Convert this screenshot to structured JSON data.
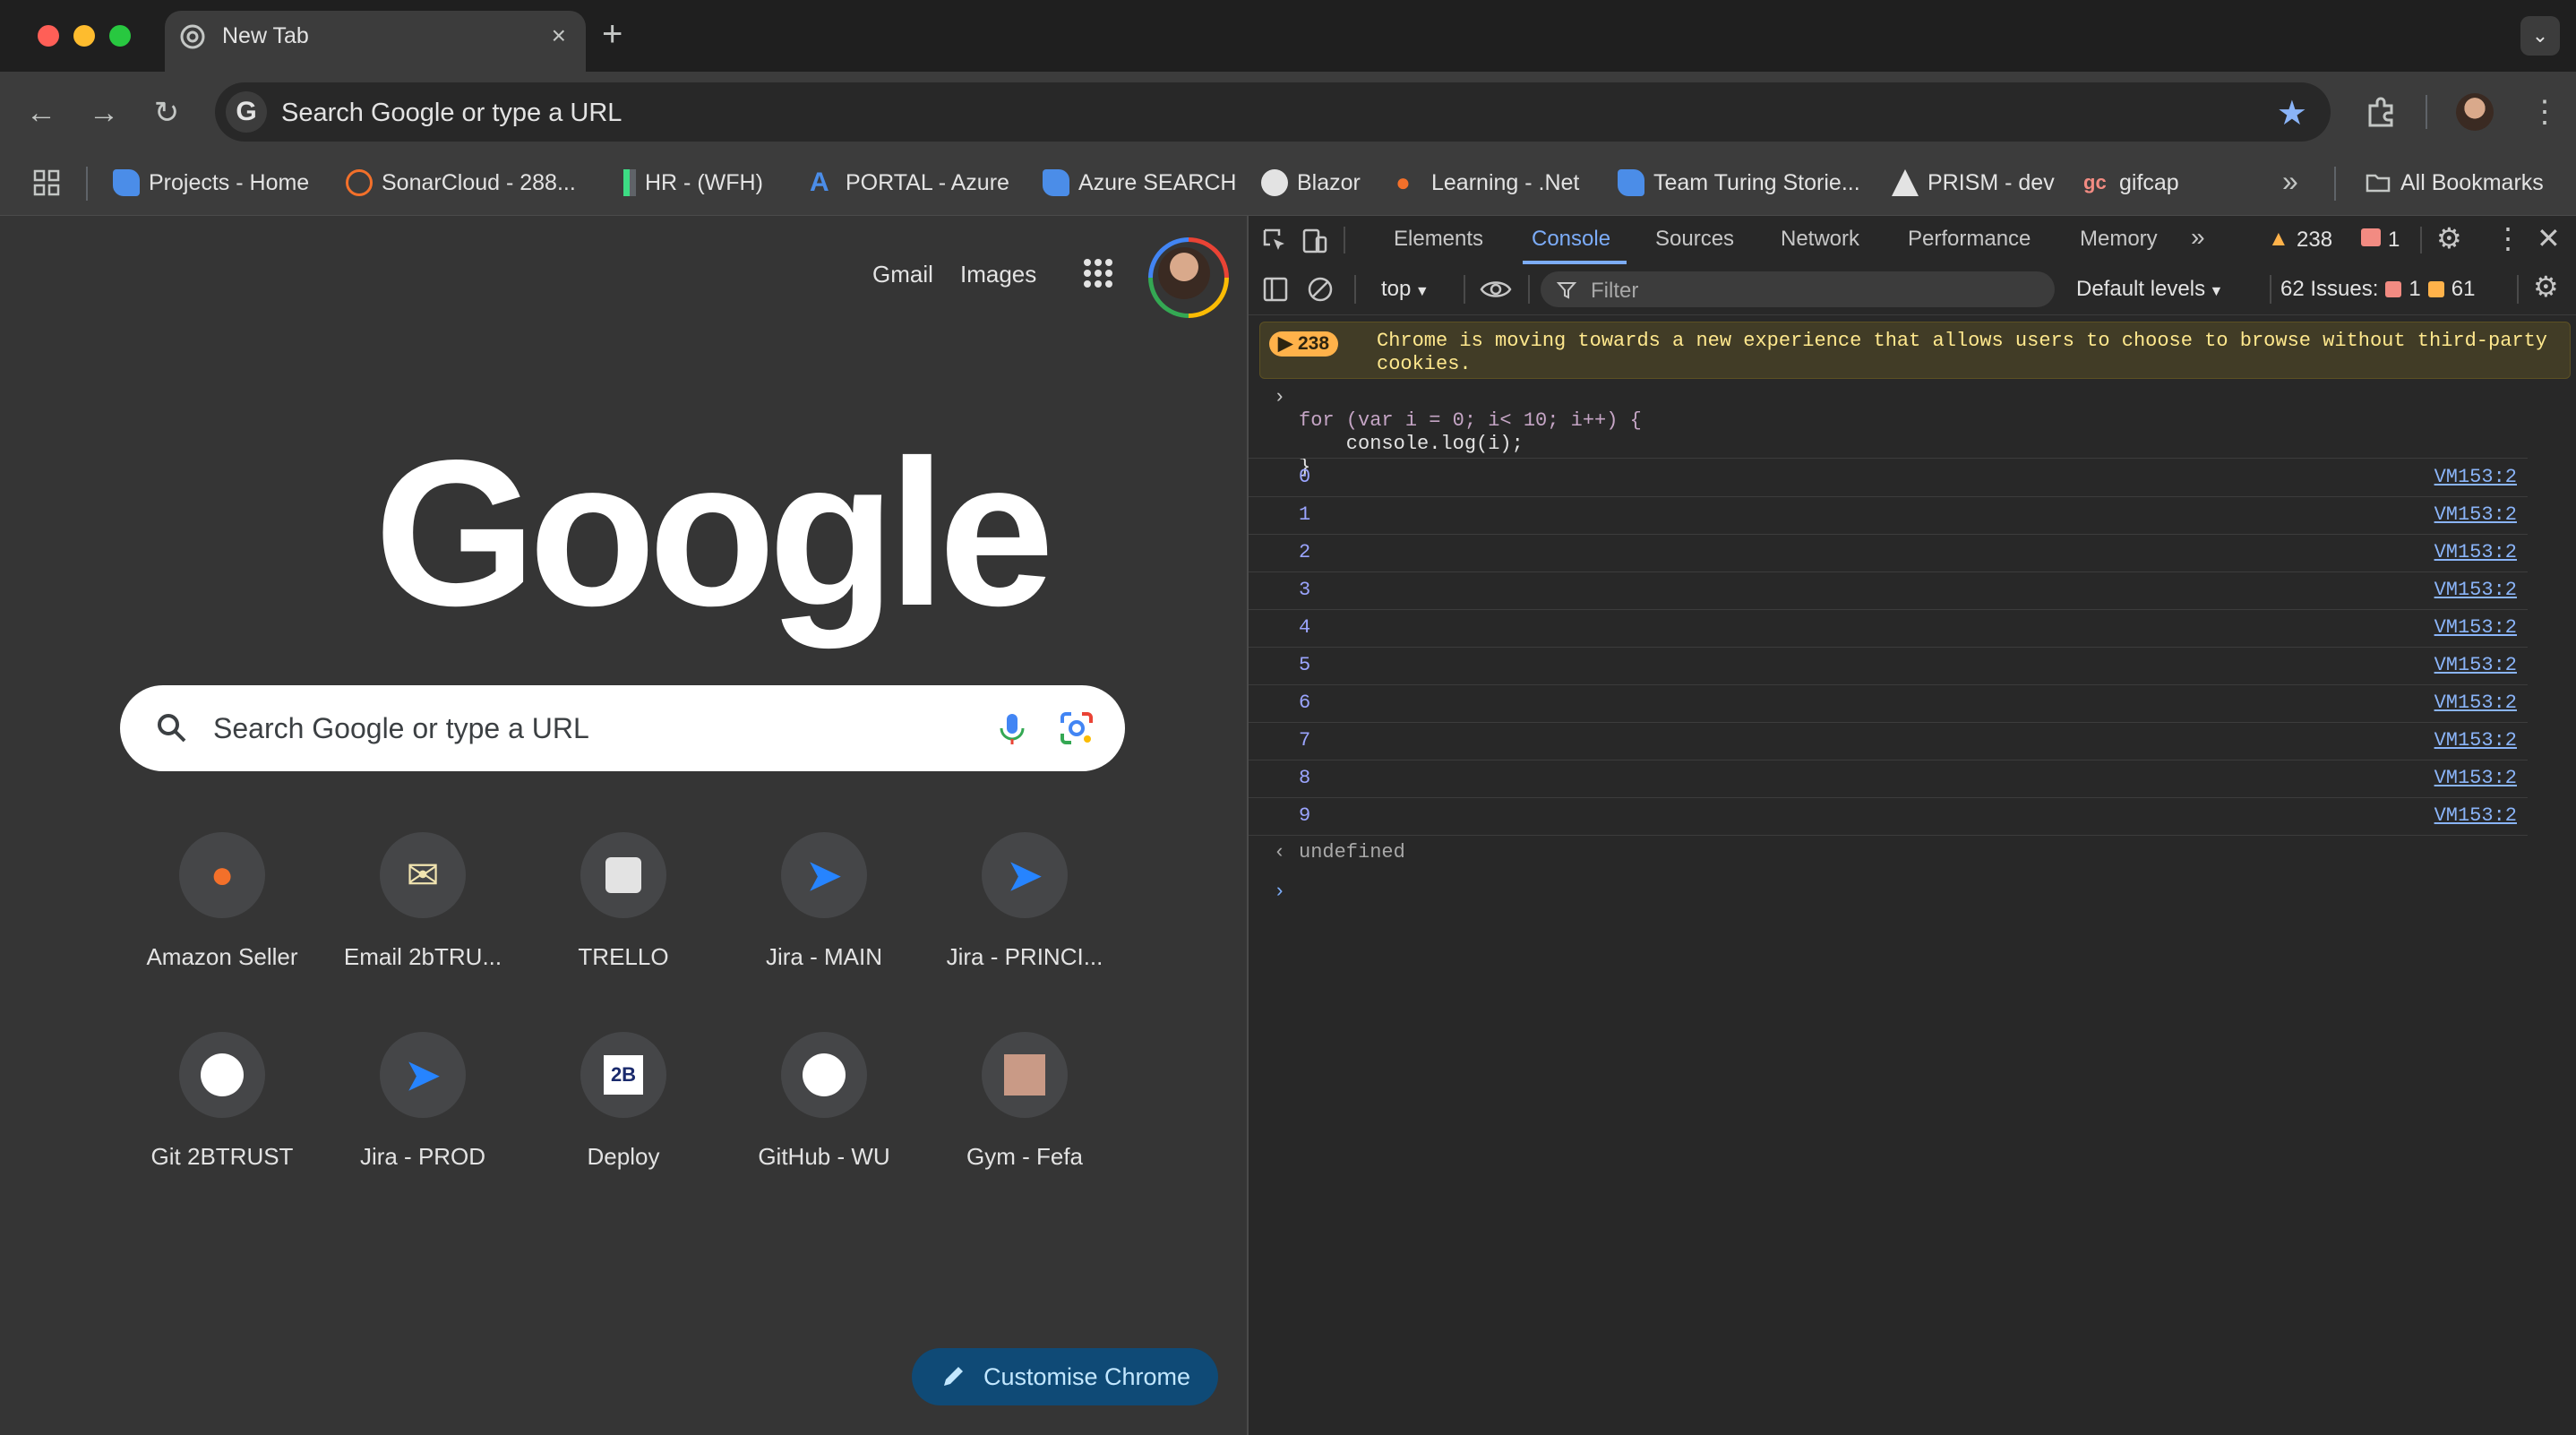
{
  "window": {
    "tab_title": "New Tab",
    "tab_close": "×",
    "new_tab": "+",
    "tab_search": "⌄"
  },
  "toolbar": {
    "omnibox_placeholder": "Search Google or type a URL"
  },
  "bookmarks": {
    "items": [
      {
        "label": "Projects - Home",
        "icon": "azure-devops-icon"
      },
      {
        "label": "SonarCloud - 288...",
        "icon": "sonarcloud-icon"
      },
      {
        "label": "HR - (WFH)",
        "icon": "hr-icon"
      },
      {
        "label": "PORTAL - Azure",
        "icon": "azure-icon"
      },
      {
        "label": "Azure SEARCH",
        "icon": "azure-devops-icon"
      },
      {
        "label": "Blazor",
        "icon": "github-icon"
      },
      {
        "label": "Learning - .Net",
        "icon": "flame-icon"
      },
      {
        "label": "Team Turing Storie...",
        "icon": "azure-devops-icon"
      },
      {
        "label": "PRISM - dev",
        "icon": "prism-icon"
      },
      {
        "label": "gifcap",
        "icon": "gifcap-icon"
      }
    ],
    "overflow": "»",
    "all_bookmarks": "All Bookmarks"
  },
  "ntp": {
    "gmail": "Gmail",
    "images": "Images",
    "logo": "Google",
    "search_placeholder": "Search Google or type a URL",
    "shortcuts": [
      {
        "label": "Amazon Seller",
        "icon": "flame-icon"
      },
      {
        "label": "Email 2bTRU...",
        "icon": "mail-icon"
      },
      {
        "label": "TRELLO",
        "icon": "trello-icon"
      },
      {
        "label": "Jira - MAIN",
        "icon": "jira-icon"
      },
      {
        "label": "Jira - PRINCI...",
        "icon": "jira-icon"
      },
      {
        "label": "Git 2BTRUST",
        "icon": "github-icon"
      },
      {
        "label": "Jira - PROD",
        "icon": "jira-icon"
      },
      {
        "label": "Deploy",
        "icon": "2b-icon"
      },
      {
        "label": "GitHub - WU",
        "icon": "github-icon"
      },
      {
        "label": "Gym - Fefa",
        "icon": "fefa-icon"
      }
    ],
    "customise": "Customise Chrome"
  },
  "devtools": {
    "tabs": [
      "Elements",
      "Console",
      "Sources",
      "Network",
      "Performance",
      "Memory"
    ],
    "more_tabs": "»",
    "warnings_count": "238",
    "errors_count": "1",
    "context": "top",
    "filter_placeholder": "Filter",
    "levels": "Default levels",
    "issues_label": "62 Issues:",
    "issues_errors": "1",
    "issues_warnings": "61",
    "warning_badge": "238",
    "warning_message": "Chrome is moving towards a new experience that allows users to choose to browse without third-party cookies.",
    "code_lines": [
      "for (var i = 0; i< 10; i++) {",
      "    console.log(i);",
      "}"
    ],
    "logs": [
      {
        "value": "0",
        "source": "VM153:2"
      },
      {
        "value": "1",
        "source": "VM153:2"
      },
      {
        "value": "2",
        "source": "VM153:2"
      },
      {
        "value": "3",
        "source": "VM153:2"
      },
      {
        "value": "4",
        "source": "VM153:2"
      },
      {
        "value": "5",
        "source": "VM153:2"
      },
      {
        "value": "6",
        "source": "VM153:2"
      },
      {
        "value": "7",
        "source": "VM153:2"
      },
      {
        "value": "8",
        "source": "VM153:2"
      },
      {
        "value": "9",
        "source": "VM153:2"
      }
    ],
    "result": "undefined"
  },
  "colors": {
    "accent": "#7cacf8",
    "warning": "#ffb24a",
    "error": "#f28b82"
  }
}
